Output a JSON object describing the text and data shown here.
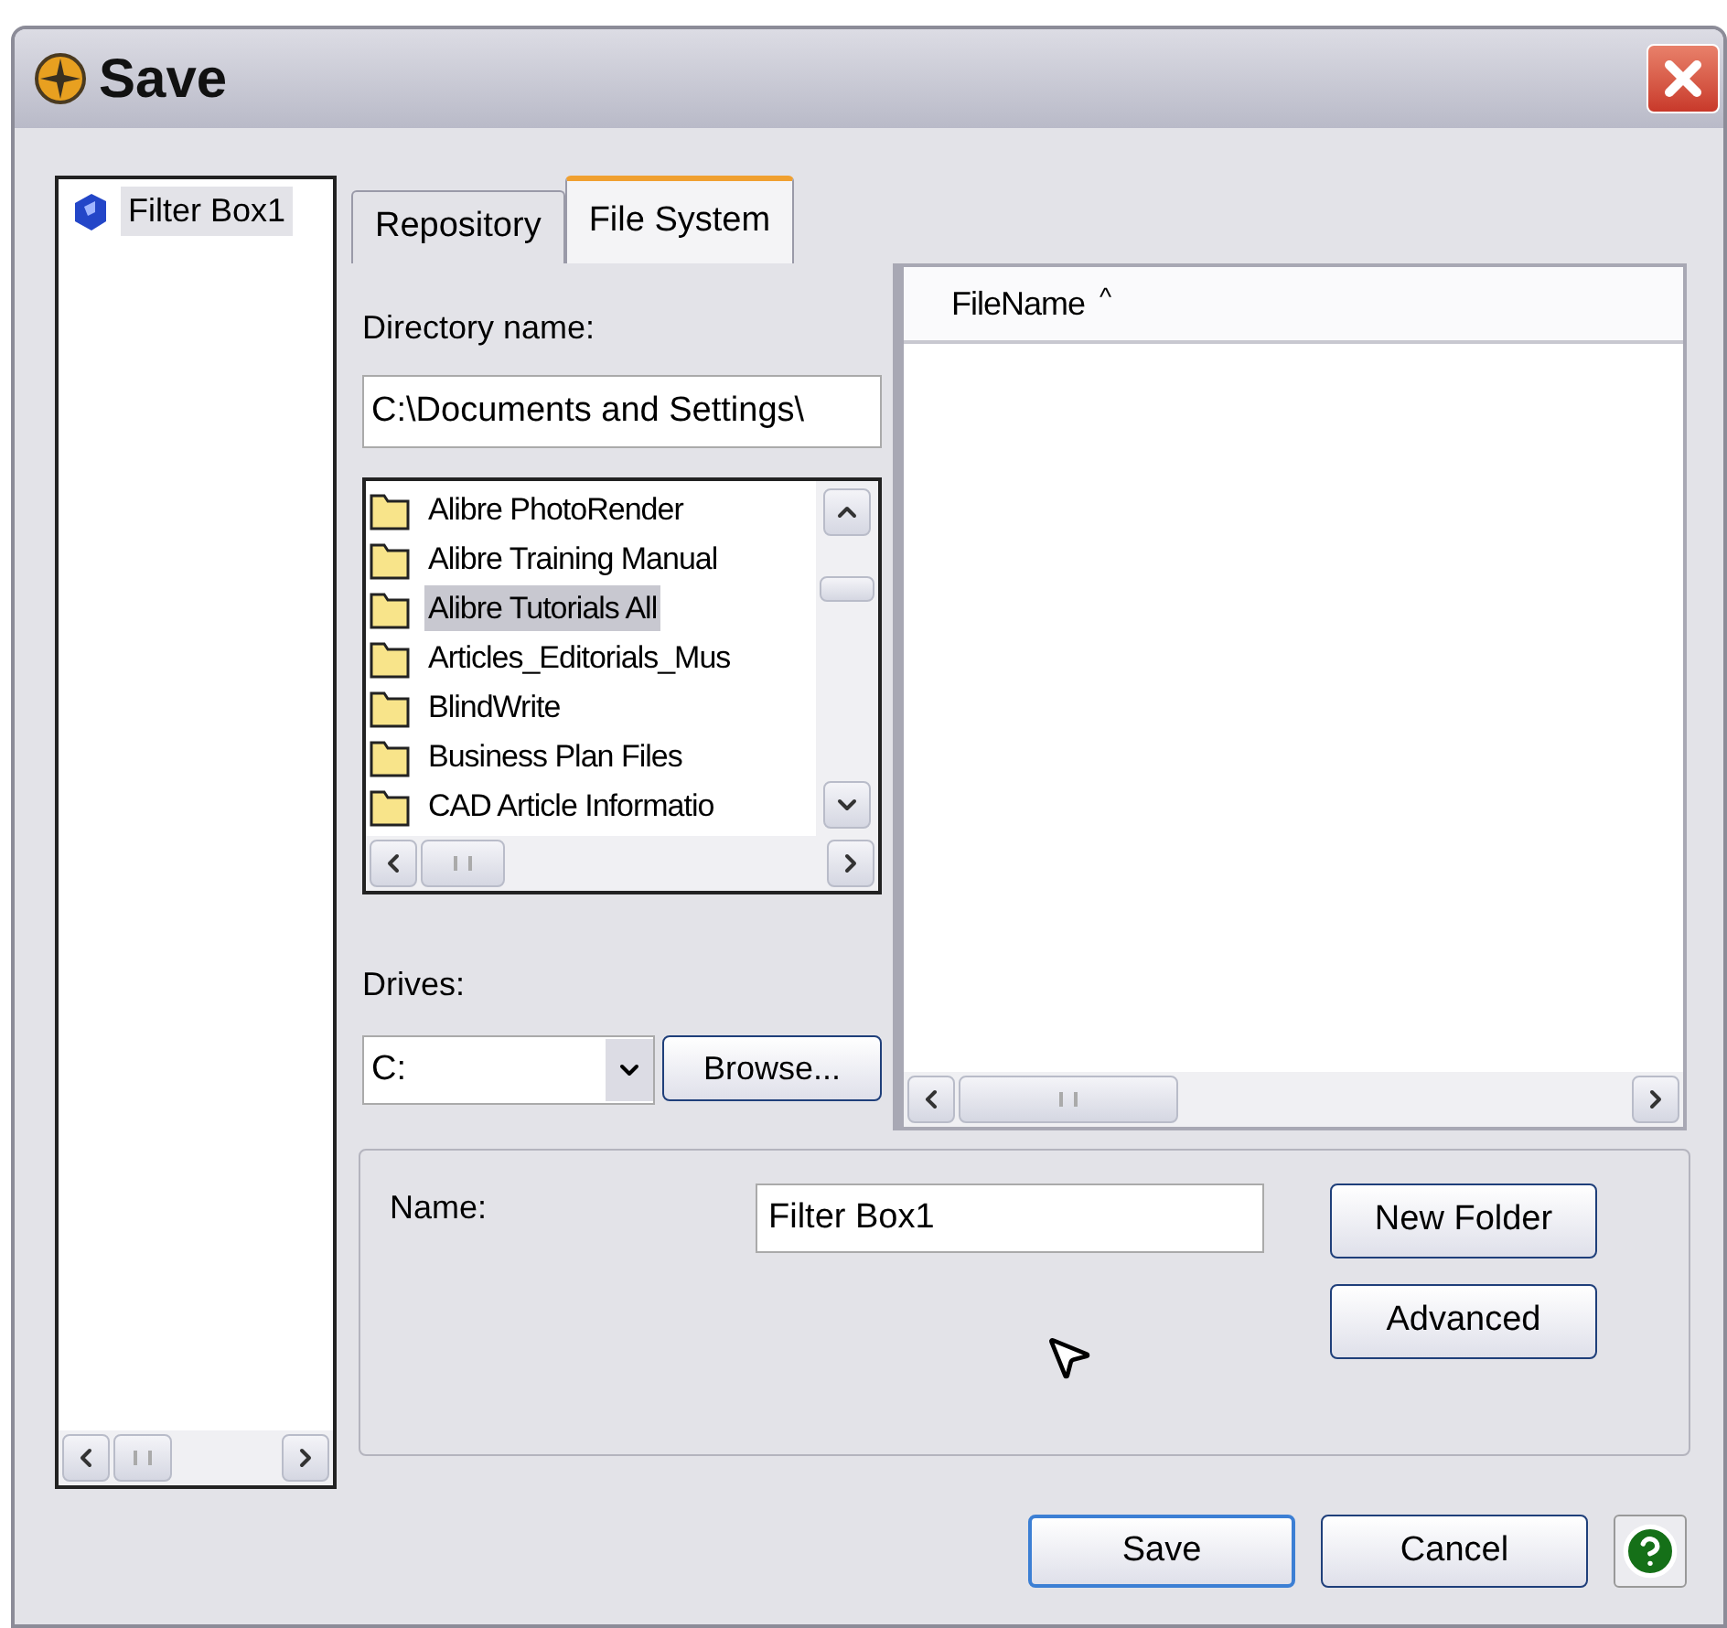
{
  "window": {
    "title": "Save"
  },
  "tree": {
    "items": [
      {
        "label": "Filter Box1",
        "selected": true
      }
    ]
  },
  "tabs": [
    {
      "label": "Repository",
      "selected": false
    },
    {
      "label": "File System",
      "selected": true
    }
  ],
  "directory": {
    "label": "Directory name:",
    "value": "C:\\Documents and Settings\\",
    "folders": [
      {
        "label": "Alibre PhotoRender",
        "selected": false
      },
      {
        "label": "Alibre Training Manual",
        "selected": false
      },
      {
        "label": "Alibre Tutorials All",
        "selected": true
      },
      {
        "label": "Articles_Editorials_Mus",
        "selected": false
      },
      {
        "label": "BlindWrite",
        "selected": false
      },
      {
        "label": "Business Plan Files",
        "selected": false
      },
      {
        "label": "CAD Article Informatio",
        "selected": false
      }
    ]
  },
  "drives": {
    "label": "Drives:",
    "value": "C:",
    "browse": "Browse..."
  },
  "file_list": {
    "columns": [
      {
        "label": "FileName",
        "sort": "^"
      }
    ]
  },
  "name_field": {
    "label": "Name:",
    "value": "Filter Box1"
  },
  "side_buttons": [
    "New Folder",
    "Advanced"
  ],
  "buttons": [
    {
      "label": "Save",
      "default": true
    },
    {
      "label": "Cancel",
      "default": false
    }
  ]
}
